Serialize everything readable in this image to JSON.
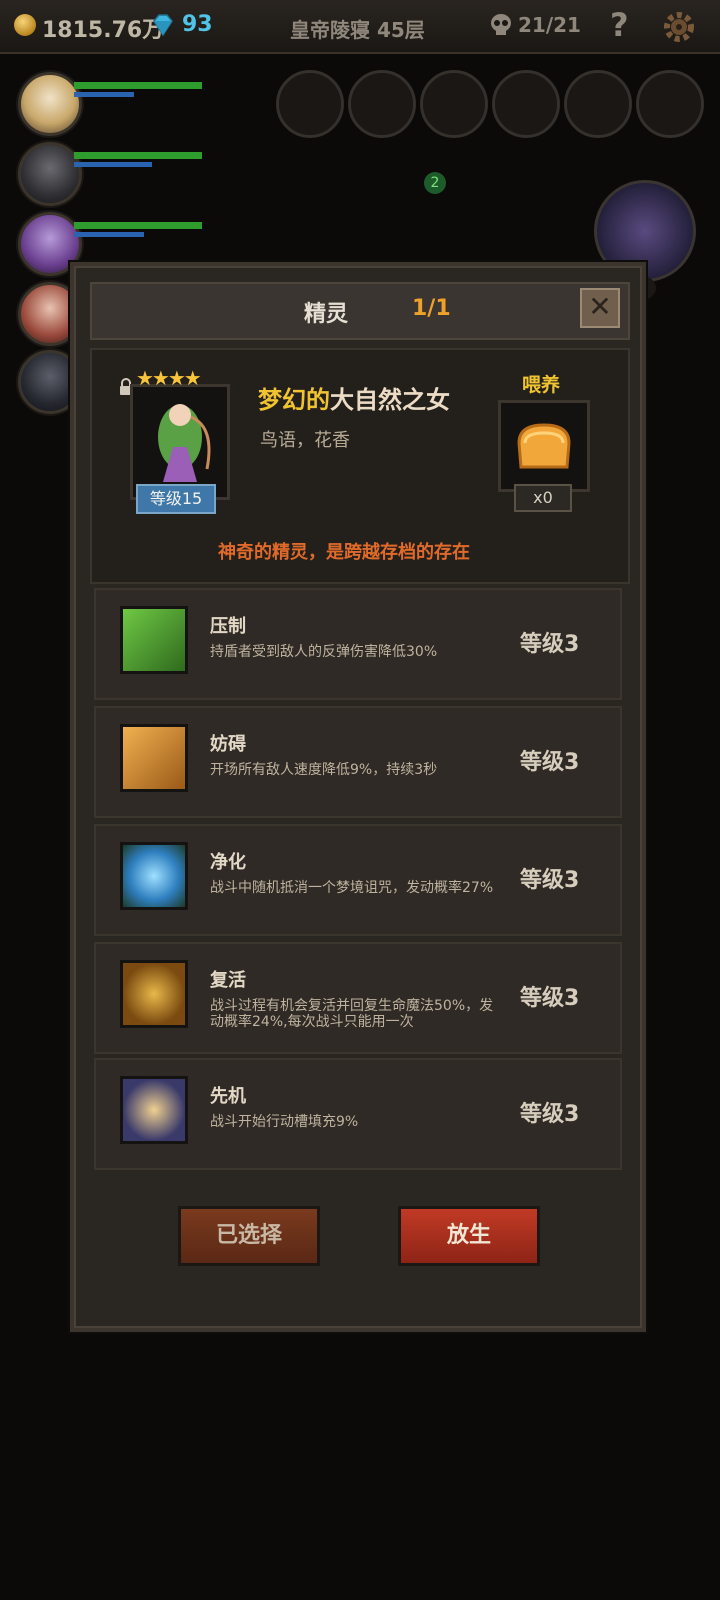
{
  "topbar": {
    "gold": "1815.76万",
    "gems": "93",
    "floor": "皇帝陵寝 45层",
    "kills": "21/21",
    "help": "?"
  },
  "dialog": {
    "title": "精灵",
    "count": "1/1",
    "close": "✕",
    "sprite": {
      "stars": "★★★★",
      "level": "等级15",
      "name_highlight": "梦幻的",
      "name_rest": "大自然之女",
      "desc": "鸟语，花香"
    },
    "feed": {
      "label": "喂养",
      "count": "x0"
    },
    "flavor": "神奇的精灵，是跨越存档的存在",
    "skills": [
      {
        "name": "压制",
        "desc": "持盾者受到敌人的反弹伤害降低30%",
        "level": "等级3"
      },
      {
        "name": "妨碍",
        "desc": "开场所有敌人速度降低9%，持续3秒",
        "level": "等级3"
      },
      {
        "name": "净化",
        "desc": "战斗中随机抵消一个梦境诅咒，发动概率27%",
        "level": "等级3"
      },
      {
        "name": "复活",
        "desc": "战斗过程有机会复活并回复生命魔法50%，发动概率24%,每次战斗只能用一次",
        "level": "等级3"
      },
      {
        "name": "先机",
        "desc": "战斗开始行动槽填充9%",
        "level": "等级3"
      }
    ],
    "buttons": {
      "selected": "已选择",
      "release": "放生"
    }
  },
  "hud": {
    "skill_badge": "2",
    "side_count": "5"
  }
}
